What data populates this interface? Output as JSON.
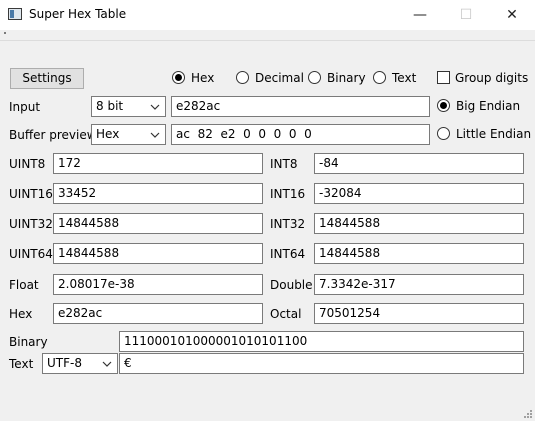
{
  "window": {
    "title": "Super Hex Table",
    "minimize": "—",
    "maximize": "☐",
    "close": "✕"
  },
  "toolbar": {
    "settings_label": "Settings",
    "formats": [
      {
        "label": "Hex",
        "selected": true
      },
      {
        "label": "Decimal",
        "selected": false
      },
      {
        "label": "Binary",
        "selected": false
      },
      {
        "label": "Text",
        "selected": false
      }
    ],
    "group_digits": {
      "label": "Group digits",
      "checked": false
    }
  },
  "input": {
    "label": "Input",
    "type": "8 bit",
    "value": "e282ac"
  },
  "buffer": {
    "label": "Buffer preview",
    "mode": "Hex",
    "value": "ac  82  e2  0  0  0  0  0"
  },
  "endian": {
    "big": {
      "label": "Big Endian",
      "selected": true
    },
    "little": {
      "label": "Little Endian",
      "selected": false
    }
  },
  "values": {
    "uint8": {
      "label": "UINT8",
      "value": "172"
    },
    "int8": {
      "label": "INT8",
      "value": "-84"
    },
    "uint16": {
      "label": "UINT16",
      "value": "33452"
    },
    "int16": {
      "label": "INT16",
      "value": "-32084"
    },
    "uint32": {
      "label": "UINT32",
      "value": "14844588"
    },
    "int32": {
      "label": "INT32",
      "value": "14844588"
    },
    "uint64": {
      "label": "UINT64",
      "value": "14844588"
    },
    "int64": {
      "label": "INT64",
      "value": "14844588"
    },
    "float": {
      "label": "Float",
      "value": "2.08017e-38"
    },
    "double": {
      "label": "Double",
      "value": "7.3342e-317"
    },
    "hex": {
      "label": "Hex",
      "value": "e282ac"
    },
    "octal": {
      "label": "Octal",
      "value": "70501254"
    },
    "binary": {
      "label": "Binary",
      "value": "111000101000001010101100"
    },
    "text": {
      "label": "Text",
      "encoding": "UTF-8",
      "value": "€"
    }
  }
}
